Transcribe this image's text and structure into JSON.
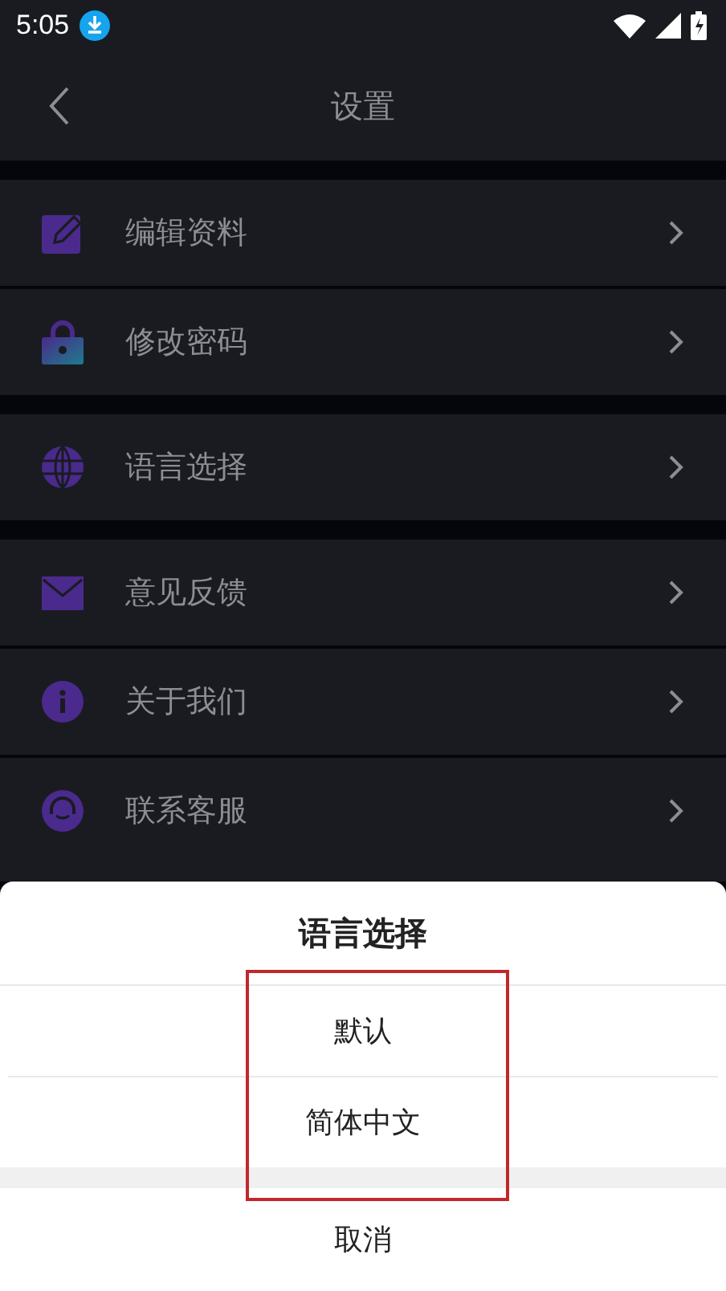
{
  "status_bar": {
    "time": "5:05"
  },
  "header": {
    "title": "设置"
  },
  "sections": [
    {
      "items": [
        {
          "label": "编辑资料"
        },
        {
          "label": "修改密码"
        }
      ]
    },
    {
      "items": [
        {
          "label": "语言选择"
        }
      ]
    },
    {
      "items": [
        {
          "label": "意见反馈"
        },
        {
          "label": "关于我们"
        },
        {
          "label": "联系客服"
        }
      ]
    }
  ],
  "sheet": {
    "title": "语言选择",
    "options": [
      {
        "label": "默认"
      },
      {
        "label": "简体中文"
      }
    ],
    "cancel": "取消",
    "highlighted": true
  }
}
